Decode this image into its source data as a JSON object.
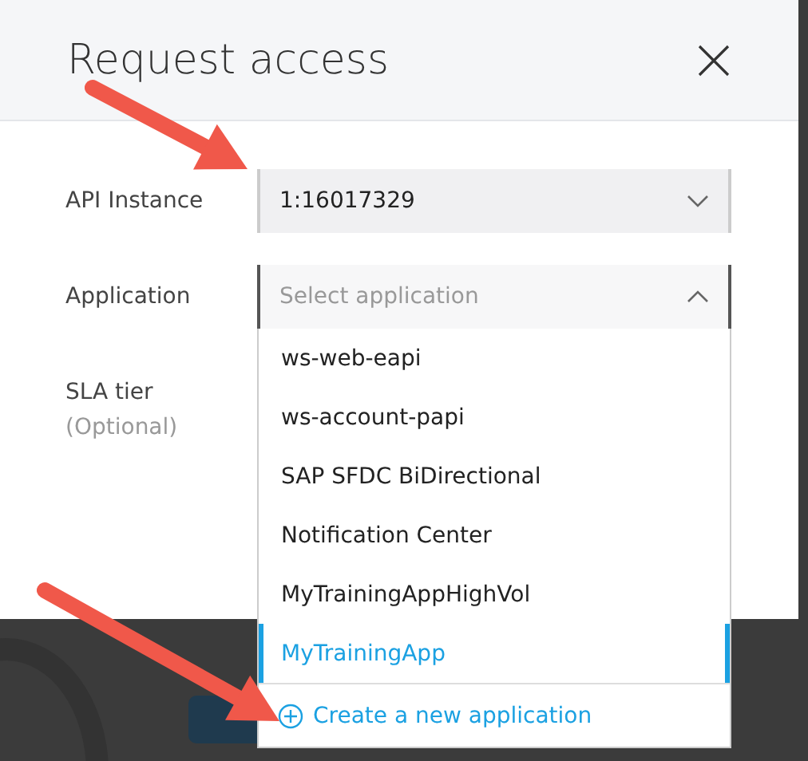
{
  "dialog": {
    "title": "Request access"
  },
  "fields": [
    {
      "label": "API Instance",
      "kind": "select",
      "value": "1:16017329",
      "expanded": false
    },
    {
      "label": "Application",
      "kind": "select",
      "placeholder": "Select application",
      "expanded": true,
      "options": [
        {
          "label": "ws-web-eapi",
          "selected": false
        },
        {
          "label": "ws-account-papi",
          "selected": false
        },
        {
          "label": "SAP SFDC BiDirectional",
          "selected": false
        },
        {
          "label": "Notification Center",
          "selected": false
        },
        {
          "label": "MyTrainingAppHighVol",
          "selected": false
        },
        {
          "label": "MyTrainingApp",
          "selected": true
        }
      ],
      "action": "Create a new application"
    },
    {
      "label": "SLA tier",
      "hint": "(Optional)",
      "kind": "empty"
    }
  ]
}
